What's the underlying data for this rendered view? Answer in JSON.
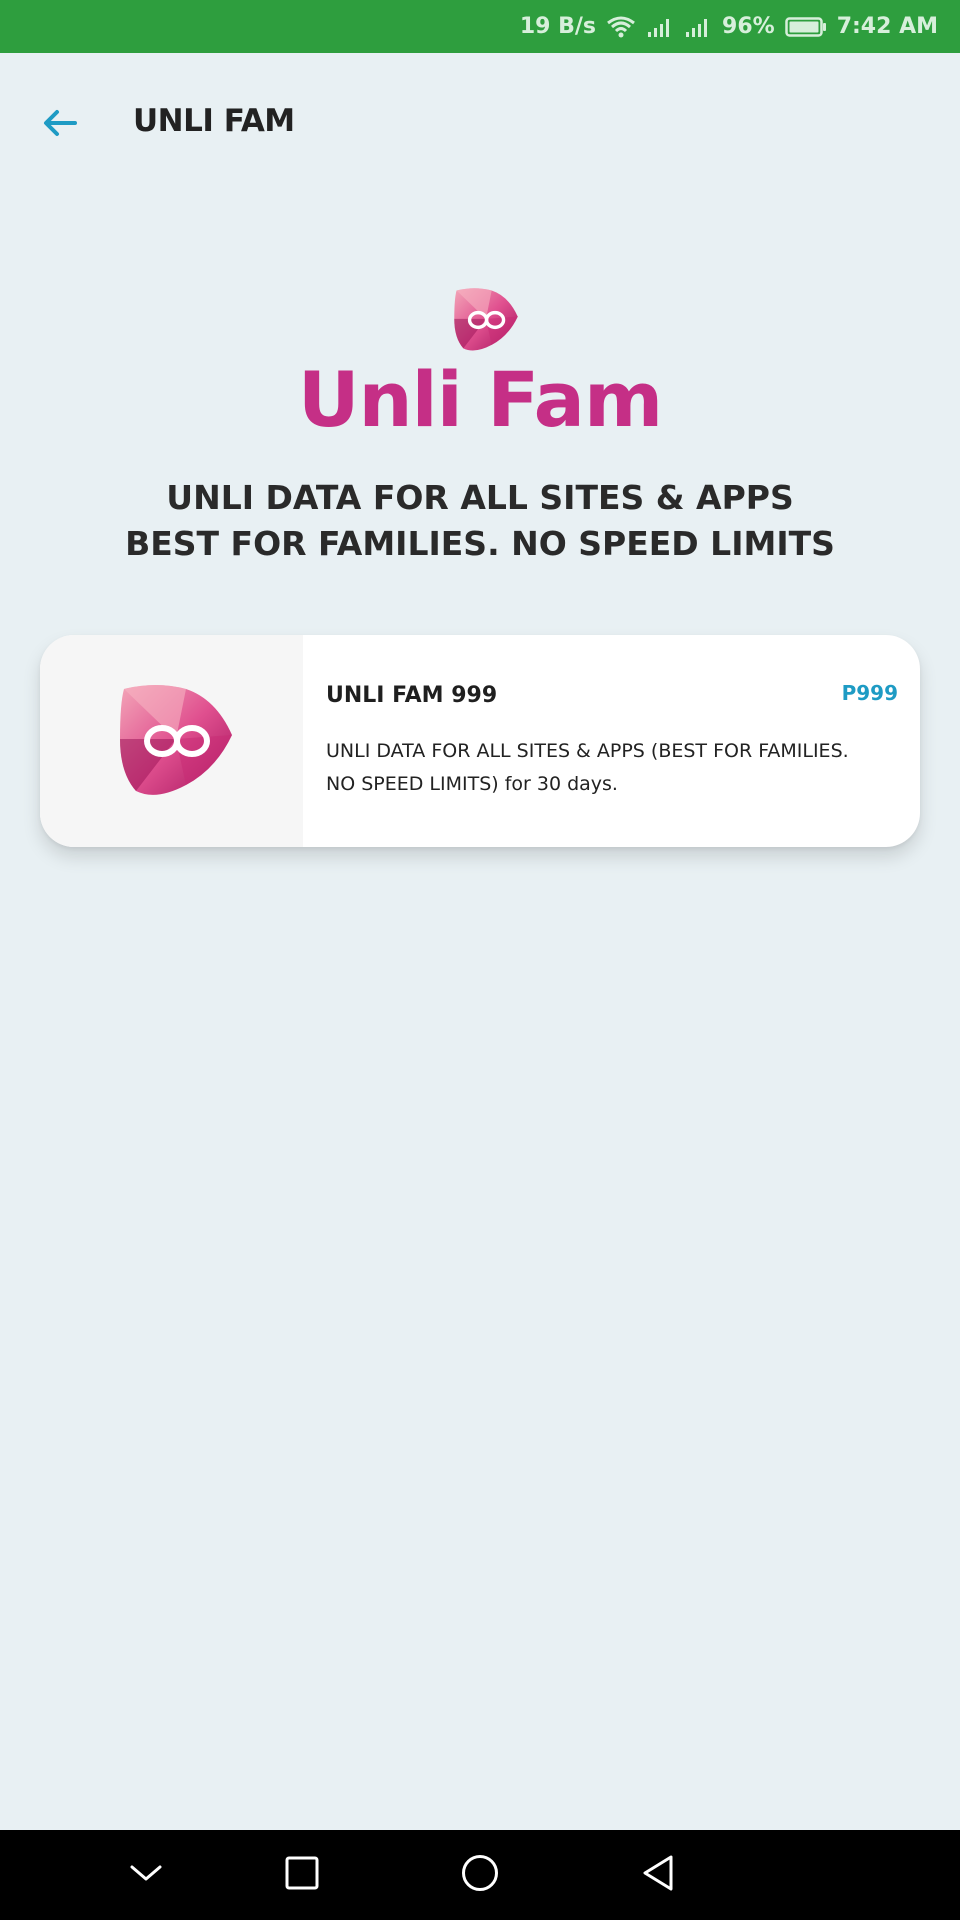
{
  "status_bar": {
    "net_speed": "19 B/s",
    "battery": "96%",
    "time": "7:42 AM",
    "icons": [
      "wifi-icon",
      "signal-icon",
      "signal-icon",
      "battery-icon"
    ]
  },
  "header": {
    "back_icon": "arrow-left-icon",
    "title": "UNLI FAM"
  },
  "hero": {
    "logo_icon": "infinity-shield-icon",
    "brand": "Unli Fam",
    "tagline_line1": "UNLI DATA FOR ALL SITES & APPS",
    "tagline_line2": "BEST FOR FAMILIES. NO SPEED LIMITS"
  },
  "promos": [
    {
      "icon": "infinity-shield-icon",
      "name": "UNLI FAM 999",
      "price": "P999",
      "description_line1": "UNLI DATA FOR ALL SITES & APPS (BEST FOR FAMILIES.",
      "description_line2": "NO SPEED LIMITS) for 30 days."
    }
  ],
  "nav_bar": {
    "buttons": [
      "chevron-down-icon",
      "square-icon",
      "circle-icon",
      "triangle-back-icon"
    ]
  },
  "colors": {
    "status_bar": "#2e9e3e",
    "background": "#e8f0f3",
    "brand_pink": "#c52f86",
    "accent_blue": "#1e9bc4"
  }
}
